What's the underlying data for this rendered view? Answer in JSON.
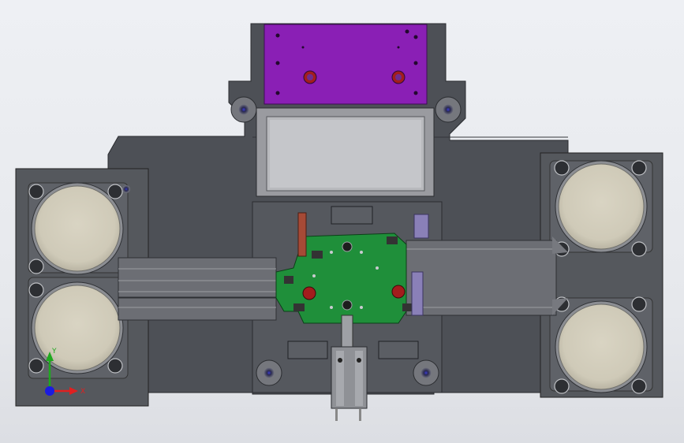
{
  "viewport": {
    "background_top": "#eef0f4",
    "background_bottom": "#dcdee3"
  },
  "model": {
    "base_color": "#4d5056",
    "steel_color": "#5d6067",
    "ring_color": "#8c8e93",
    "cylinder_color": "#d8d3c2",
    "purple_plate_color": "#8a1fb5",
    "green_pcb_color": "#1f8f3a",
    "red_accent_color": "#a31d1d"
  },
  "triad": {
    "x_label": "X",
    "y_label": "Y",
    "x_color": "#e02020",
    "y_color": "#1fa81f",
    "z_color": "#1b1be0",
    "icon": "coordinate-triad-icon"
  }
}
